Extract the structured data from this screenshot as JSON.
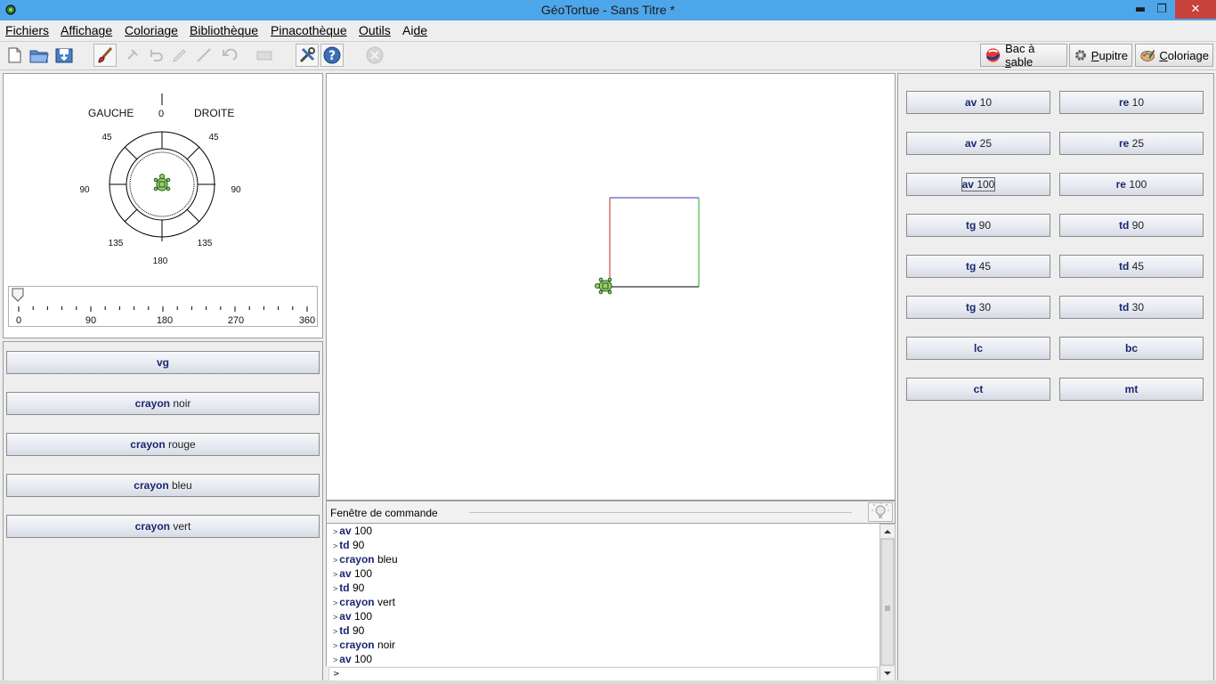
{
  "window": {
    "title": "GéoTortue - Sans Titre *",
    "min_label": "▬",
    "restore_label": "❐",
    "close_label": "✕"
  },
  "menu": {
    "items": [
      {
        "key": "F",
        "rest": "ichiers"
      },
      {
        "key": "A",
        "rest": "ffichage"
      },
      {
        "key": "C",
        "rest": "oloriage"
      },
      {
        "key": "B",
        "rest": "ibliothèque"
      },
      {
        "key": "P",
        "rest": "inacothèque"
      },
      {
        "key": "O",
        "rest": "utils"
      },
      {
        "key": "Ai",
        "rest": "de",
        "underline_full": false
      }
    ]
  },
  "toolbar": {
    "icons": [
      "new-file-icon",
      "open-folder-icon",
      "save-icon",
      "brush-icon",
      "pin-icon",
      "undo-icon",
      "pencil-icon",
      "line-icon",
      "back-icon",
      "eraser-icon",
      "tools-icon",
      "help-icon",
      "stop-icon"
    ],
    "tabs": [
      {
        "pre": "Bac à ",
        "key": "s",
        "post": "able"
      },
      {
        "pre": "",
        "key": "P",
        "post": "upitre"
      },
      {
        "pre": "",
        "key": "C",
        "post": "oloriage"
      }
    ]
  },
  "compass": {
    "gauche": "GAUCHE",
    "droite": "DROITE",
    "top": "0",
    "nw": "45",
    "ne": "45",
    "w": "90",
    "e": "90",
    "sw": "135",
    "se": "135",
    "bottom": "180"
  },
  "slider": {
    "labels": [
      "0",
      "90",
      "180",
      "270",
      "360"
    ],
    "value": 0
  },
  "left_buttons": [
    {
      "cmd": "vg",
      "arg": ""
    },
    {
      "cmd": "crayon",
      "arg": "noir"
    },
    {
      "cmd": "crayon",
      "arg": "rouge"
    },
    {
      "cmd": "crayon",
      "arg": "bleu"
    },
    {
      "cmd": "crayon",
      "arg": "vert"
    }
  ],
  "right_buttons": [
    {
      "cmd": "av",
      "arg": "10"
    },
    {
      "cmd": "re",
      "arg": "10"
    },
    {
      "cmd": "av",
      "arg": "25"
    },
    {
      "cmd": "re",
      "arg": "25"
    },
    {
      "cmd": "av",
      "arg": "100"
    },
    {
      "cmd": "re",
      "arg": "100"
    },
    {
      "cmd": "tg",
      "arg": "90"
    },
    {
      "cmd": "td",
      "arg": "90"
    },
    {
      "cmd": "tg",
      "arg": "45"
    },
    {
      "cmd": "td",
      "arg": "45"
    },
    {
      "cmd": "tg",
      "arg": "30"
    },
    {
      "cmd": "td",
      "arg": "30"
    },
    {
      "cmd": "lc",
      "arg": ""
    },
    {
      "cmd": "bc",
      "arg": ""
    },
    {
      "cmd": "ct",
      "arg": ""
    },
    {
      "cmd": "mt",
      "arg": ""
    }
  ],
  "command_window": {
    "title": "Fenêtre de commande",
    "prompt": ">",
    "history": [
      {
        "cmd": "av",
        "arg": "100"
      },
      {
        "cmd": "td",
        "arg": "90"
      },
      {
        "cmd": "crayon",
        "arg": "bleu"
      },
      {
        "cmd": "av",
        "arg": "100"
      },
      {
        "cmd": "td",
        "arg": "90"
      },
      {
        "cmd": "crayon",
        "arg": "vert"
      },
      {
        "cmd": "av",
        "arg": "100"
      },
      {
        "cmd": "td",
        "arg": "90"
      },
      {
        "cmd": "crayon",
        "arg": "noir"
      },
      {
        "cmd": "av",
        "arg": "100"
      }
    ]
  },
  "drawing": {
    "colors": {
      "left": "#cc2222",
      "top": "#3333bb",
      "right": "#22aa22",
      "bottom": "#000000"
    }
  }
}
